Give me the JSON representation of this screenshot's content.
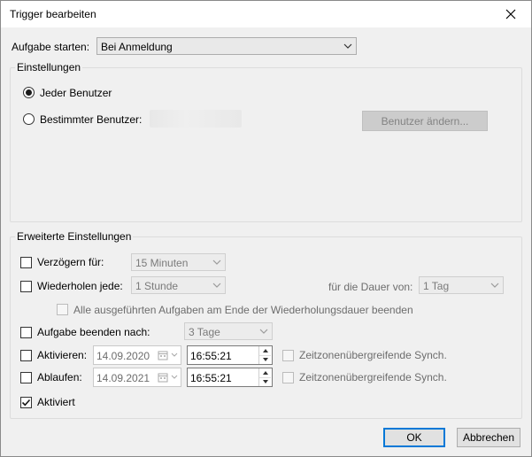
{
  "window": {
    "title": "Trigger bearbeiten",
    "close_icon": "close-icon"
  },
  "start": {
    "label": "Aufgabe starten:",
    "value": "Bei Anmeldung"
  },
  "settings": {
    "group_title": "Einstellungen",
    "radio_any_user": "Jeder Benutzer",
    "radio_specific_user": "Bestimmter Benutzer:",
    "selected_radio": "any_user",
    "change_user_button": "Benutzer ändern..."
  },
  "advanced": {
    "group_title": "Erweiterte Einstellungen",
    "delay": {
      "label": "Verzögern für:",
      "value": "15 Minuten",
      "checked": false
    },
    "repeat": {
      "label": "Wiederholen jede:",
      "value": "1 Stunde",
      "checked": false,
      "duration_label": "für die Dauer von:",
      "duration_value": "1 Tag"
    },
    "stop_all": {
      "label": "Alle ausgeführten Aufgaben am Ende der Wiederholungsdauer beenden",
      "checked": false
    },
    "stop_task": {
      "label": "Aufgabe beenden nach:",
      "value": "3 Tage",
      "checked": false
    },
    "activate": {
      "label": "Aktivieren:",
      "date": "14.09.2020",
      "time": "16:55:21",
      "checked": false,
      "sync_label": "Zeitzonenübergreifende Synch."
    },
    "expire": {
      "label": "Ablaufen:",
      "date": "14.09.2021",
      "time": "16:55:21",
      "checked": false,
      "sync_label": "Zeitzonenübergreifende Synch."
    },
    "enabled": {
      "label": "Aktiviert",
      "checked": true
    }
  },
  "buttons": {
    "ok": "OK",
    "cancel": "Abbrechen"
  },
  "colors": {
    "dialog_bg": "#f0f0f0",
    "accent": "#0078d7",
    "disabled_text": "#6d6d6d"
  }
}
